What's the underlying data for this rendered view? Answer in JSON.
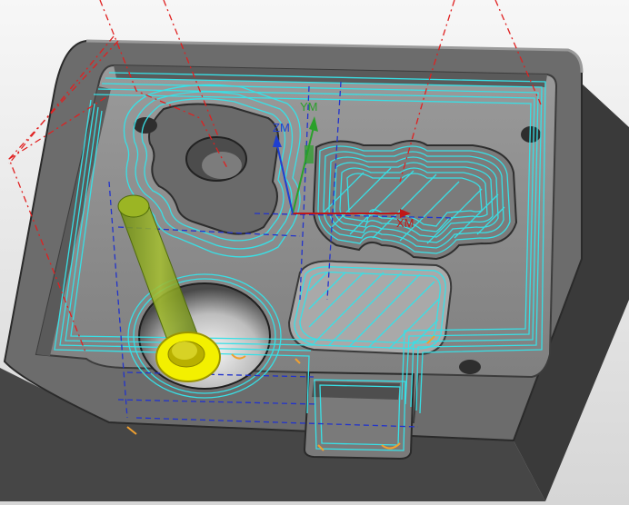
{
  "viewport": {
    "background_top": "#f7f7f7",
    "background_bottom": "#d6d6d6"
  },
  "axes": {
    "xm_label": "XM",
    "ym_label": "YM",
    "zm_label": "ZM",
    "x_color": "#c01818",
    "y_color": "#2aa02a",
    "z_color": "#1f3fd0"
  },
  "colors": {
    "part_top": "#6e6e6e",
    "part_side_dark": "#3a3a3a",
    "part_side_mid": "#4a4a4a",
    "floor": "#8a8a8a",
    "toolpath": "#38e0e6",
    "rapid_path": "#e02020",
    "engage_path": "#2233cc",
    "tool_shank": "#8aa820",
    "tool_holder": "#f3f000",
    "lead_marks": "#f0a030"
  },
  "icons": {
    "tool": "end-mill-tool-icon",
    "wcs": "coordinate-system-icon"
  }
}
